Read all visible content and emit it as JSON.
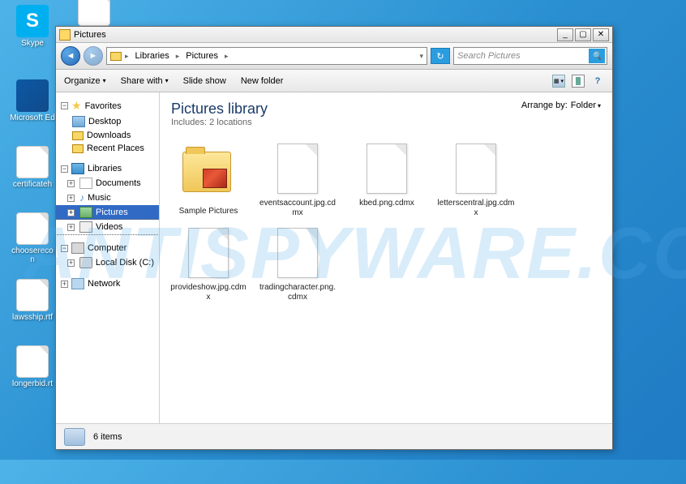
{
  "watermark": "ANTISPYWARE.CO",
  "desktop": {
    "icons": [
      {
        "label": "Skype",
        "type": "skype"
      },
      {
        "label": "",
        "type": "doc"
      },
      {
        "label": "Microsoft Ed",
        "type": "edge"
      },
      {
        "label": "certificateh",
        "type": "doc"
      },
      {
        "label": "chooserecon",
        "type": "doc"
      },
      {
        "label": "lawsship.rtf",
        "type": "doc"
      },
      {
        "label": "longerbid.rt",
        "type": "doc"
      }
    ]
  },
  "window": {
    "title": "Pictures",
    "breadcrumb": [
      "Libraries",
      "Pictures"
    ],
    "search_placeholder": "Search Pictures",
    "toolbar": {
      "organize": "Organize",
      "share": "Share with",
      "slideshow": "Slide show",
      "newfolder": "New folder"
    },
    "tree": {
      "favorites": {
        "label": "Favorites",
        "items": [
          "Desktop",
          "Downloads",
          "Recent Places"
        ]
      },
      "libraries": {
        "label": "Libraries",
        "items": [
          "Documents",
          "Music",
          "Pictures",
          "Videos"
        ]
      },
      "computer": {
        "label": "Computer",
        "items": [
          "Local Disk (C:)"
        ]
      },
      "network": {
        "label": "Network"
      }
    },
    "content": {
      "title": "Pictures library",
      "subtitle": "Includes: 2 locations",
      "arrange_label": "Arrange by:",
      "arrange_value": "Folder",
      "items": [
        {
          "name": "Sample Pictures",
          "type": "folder"
        },
        {
          "name": "eventsaccount.jpg.cdmx",
          "type": "file"
        },
        {
          "name": "kbed.png.cdmx",
          "type": "file"
        },
        {
          "name": "letterscentral.jpg.cdmx",
          "type": "file"
        },
        {
          "name": "provideshow.jpg.cdmx",
          "type": "file"
        },
        {
          "name": "tradingcharacter.png.cdmx",
          "type": "file"
        }
      ]
    },
    "status": "6 items"
  }
}
